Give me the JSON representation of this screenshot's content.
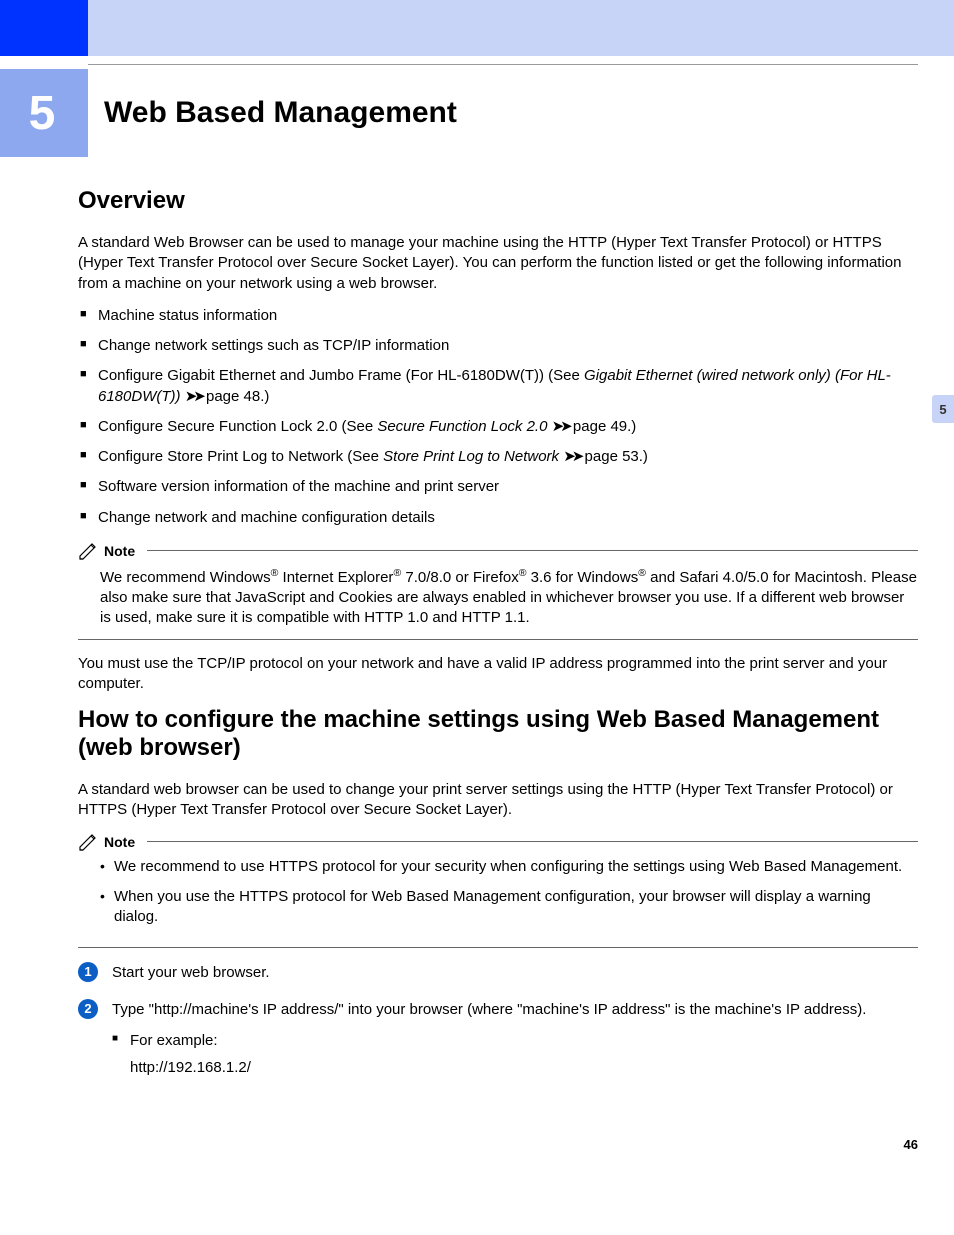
{
  "chapter": {
    "number": "5",
    "title": "Web Based Management"
  },
  "sections": {
    "overview": {
      "heading": "Overview",
      "intro": "A standard Web Browser can be used to manage your machine using the HTTP (Hyper Text Transfer Protocol) or HTTPS (Hyper Text Transfer Protocol over Secure Socket Layer). You can perform the function listed or get the following information from a machine on your network using a web browser.",
      "bullets": {
        "b1": "Machine status information",
        "b2": "Change network settings such as TCP/IP information",
        "b3_pre": "Configure Gigabit Ethernet and Jumbo Frame (For HL-6180DW(T)) (See ",
        "b3_link": "Gigabit Ethernet (wired network only) (For HL-6180DW(T))",
        "b3_post": " page 48.)",
        "b4_pre": "Configure Secure Function Lock 2.0 (See ",
        "b4_link": "Secure Function Lock 2.0",
        "b4_post": " page 49.)",
        "b5_pre": "Configure Store Print Log to Network (See ",
        "b5_link": "Store Print Log to Network",
        "b5_post": " page 53.)",
        "b6": "Software version information of the machine and print server",
        "b7": "Change network and machine configuration details"
      },
      "note_label": "Note",
      "note_body": "We recommend Windows® Internet Explorer® 7.0/8.0 or Firefox® 3.6 for Windows® and Safari 4.0/5.0 for Macintosh. Please also make sure that JavaScript and Cookies are always enabled in whichever browser you use. If a different web browser is used, make sure it is compatible with HTTP 1.0 and HTTP 1.1.",
      "closing": "You must use the TCP/IP protocol on your network and have a valid IP address programmed into the print server and your computer."
    },
    "howto": {
      "heading": "How to configure the machine settings using Web Based Management (web browser)",
      "intro": "A standard web browser can be used to change your print server settings using the HTTP (Hyper Text Transfer Protocol) or HTTPS (Hyper Text Transfer Protocol over Secure Socket Layer).",
      "note_label": "Note",
      "note_bullets": {
        "n1": "We recommend to use HTTPS protocol for your security when configuring the settings using Web Based Management.",
        "n2": "When you use the HTTPS protocol for Web Based Management configuration, your browser will display a warning dialog."
      },
      "steps": {
        "s1": "Start your web browser.",
        "s2": "Type \"http://machine's IP address/\" into your browser (where \"machine's IP address\" is the machine's IP address).",
        "s2_example_label": "For example:",
        "s2_example_url": "http://192.168.1.2/"
      }
    }
  },
  "side_tab": "5",
  "page_number": "46",
  "arrow_glyph": "➤➤"
}
